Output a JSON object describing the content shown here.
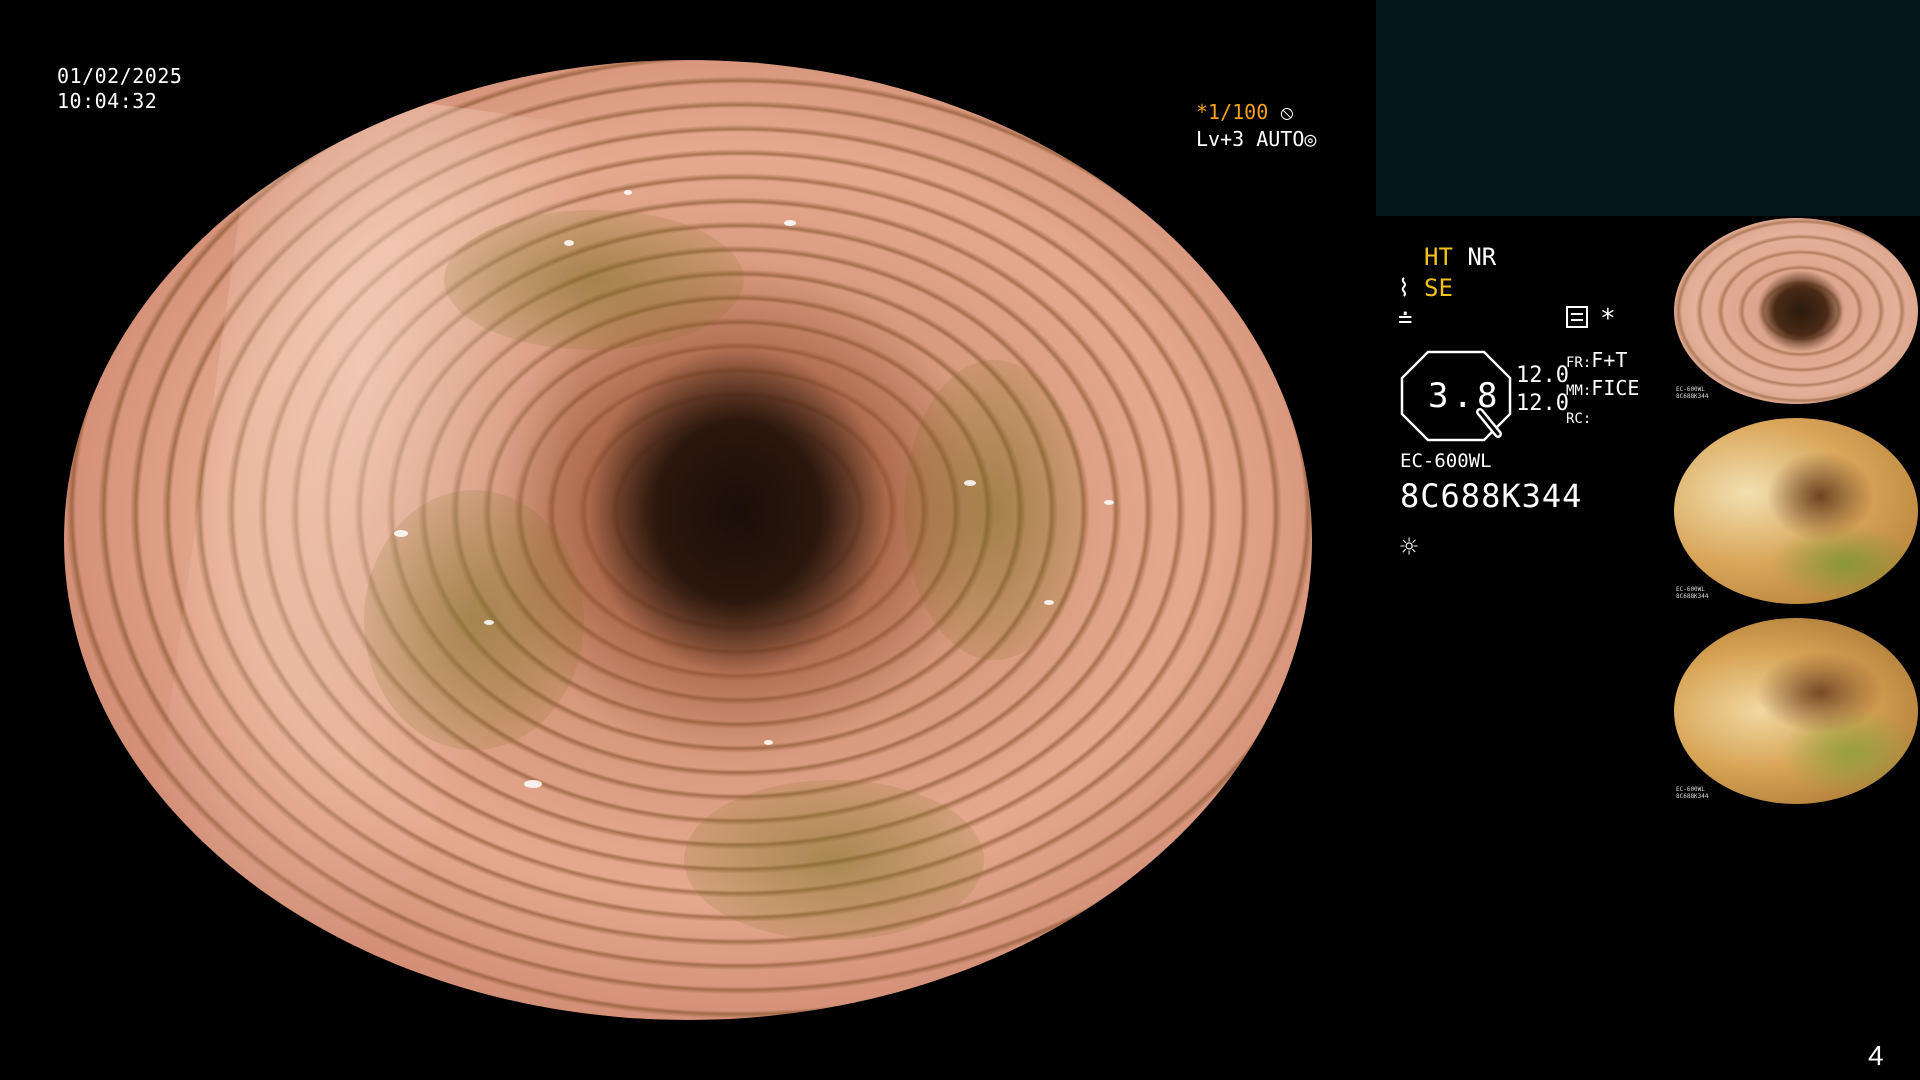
{
  "overlay": {
    "date": "01/02/2025",
    "time": "10:04:32",
    "shutter_prefix": "*",
    "shutter_speed": "1/100",
    "shutter_icon": "aperture-icon",
    "exposure_level": "Lv+3",
    "exposure_mode": "AUTO",
    "exposure_icon": "iris-icon"
  },
  "status": {
    "ht": "HT",
    "nr": "NR",
    "se": "SE",
    "se_icon": "fish-icon",
    "freeze_icon": "lightning-icon",
    "mode_icon": "menu-box-icon",
    "star": "*"
  },
  "zoom": {
    "value": "3.8",
    "a1": "12.0",
    "a2": "12.0",
    "fr_label": "FR:",
    "fr_value": "F+T",
    "mm_label": "MM:",
    "mm_value": "FICE",
    "rc_label": "RC:"
  },
  "scope": {
    "model": "EC-600WL",
    "serial": "8C688K344",
    "light_icon": "sun-icon"
  },
  "colors": {
    "accent_orange": "#f4a21b",
    "accent_yellow": "#f4c21b",
    "panel_teal": "#03181a"
  },
  "thumbnails": [
    {
      "label_model": "EC-600WL",
      "label_serial": "8C688K344"
    },
    {
      "label_model": "EC-600WL",
      "label_serial": "8C688K344"
    },
    {
      "label_model": "EC-600WL",
      "label_serial": "8C688K344"
    }
  ],
  "page_number": "4"
}
